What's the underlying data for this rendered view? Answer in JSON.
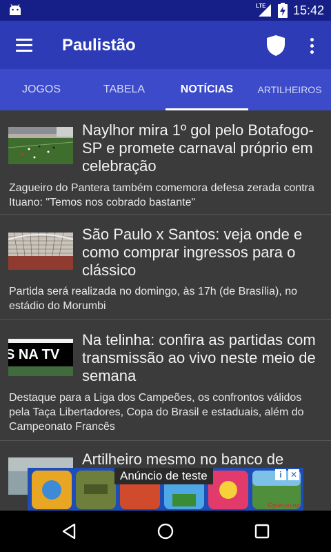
{
  "status_bar": {
    "network": "LTE",
    "time": "15:42"
  },
  "app_bar": {
    "title": "Paulistão"
  },
  "tabs": [
    {
      "label": "JOGOS",
      "active": false
    },
    {
      "label": "TABELA",
      "active": false
    },
    {
      "label": "NOTÍCIAS",
      "active": true
    },
    {
      "label": "ARTILHEIROS",
      "active": false
    }
  ],
  "news": [
    {
      "title": "Naylhor mira 1º gol pelo Botafogo-SP e promete carnaval próprio em celebração",
      "summary": "Zagueiro do Pantera também comemora defesa zerada contra Ituano: \"Temos nos cobrado bastante\"",
      "thumb": "soccer-field"
    },
    {
      "title": "São Paulo x Santos: veja onde e como comprar ingressos para o clássico",
      "summary": "Partida será realizada no domingo, às 17h (de Brasília), no estádio do Morumbi",
      "thumb": "goal-net"
    },
    {
      "title": "Na telinha: confira as partidas com transmissão ao vivo neste meio de semana",
      "summary": "Destaque para a Liga dos Campeões, os confrontos válidos pela Taça Libertadores, Copa do Brasil e estaduais, além do Campeonato Francês",
      "thumb": "na-tv-banner",
      "thumb_text": "S NA TV"
    },
    {
      "title": "Artilheiro mesmo no banco de",
      "summary": "",
      "thumb": "stadium-crowd"
    }
  ],
  "ad": {
    "label": "Anúncio de teste",
    "watermark": "Oyun.co.nz"
  },
  "colors": {
    "status_bar": "#161f87",
    "app_bar": "#2d3bb6",
    "tabs": "#3c4bc9",
    "background": "#3b3b3b"
  }
}
